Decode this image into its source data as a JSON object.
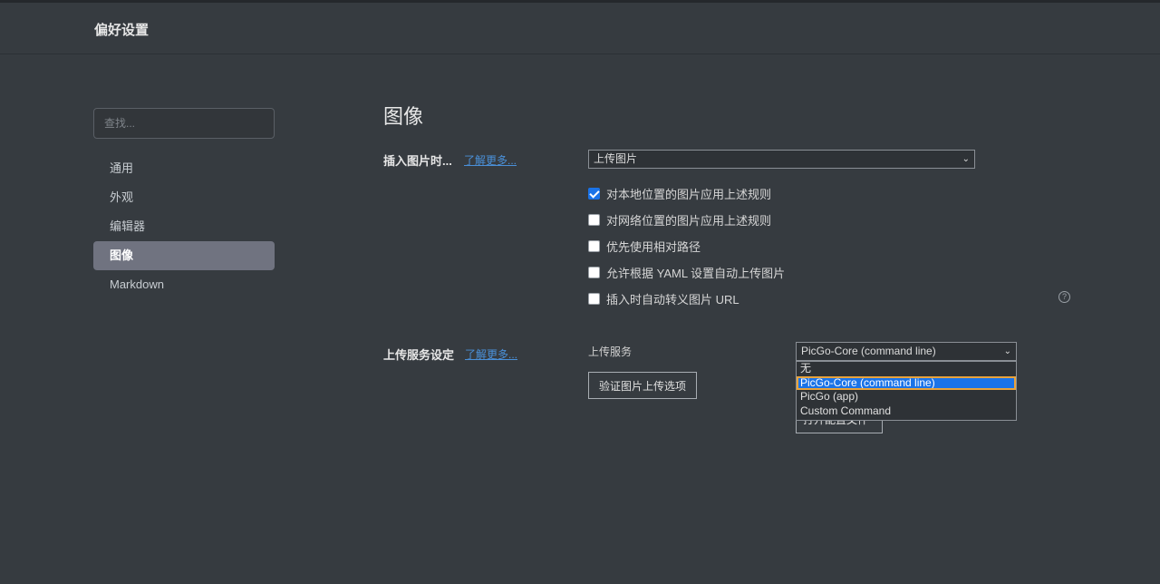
{
  "header": {
    "title": "偏好设置"
  },
  "sidebar": {
    "search_placeholder": "查找...",
    "items": [
      {
        "label": "通用"
      },
      {
        "label": "外观"
      },
      {
        "label": "编辑器"
      },
      {
        "label": "图像"
      },
      {
        "label": "Markdown"
      }
    ]
  },
  "main": {
    "title": "图像",
    "insert_section": {
      "label": "插入图片时...",
      "learn_more": "了解更多...",
      "select_value": "上传图片",
      "checkboxes": [
        {
          "label": "对本地位置的图片应用上述规则",
          "checked": true
        },
        {
          "label": "对网络位置的图片应用上述规则",
          "checked": false
        },
        {
          "label": "优先使用相对路径",
          "checked": false
        },
        {
          "label": "允许根据 YAML 设置自动上传图片",
          "checked": false
        },
        {
          "label": "插入时自动转义图片 URL",
          "checked": false
        }
      ],
      "help_icon": "question-circle-icon"
    },
    "upload_section": {
      "label": "上传服务设定",
      "learn_more": "了解更多...",
      "service_label": "上传服务",
      "service_value": "PicGo-Core (command line)",
      "verify_button": "验证图片上传选项",
      "open_config_button": "打开配置文件",
      "dropdown_options": [
        {
          "label": "无",
          "selected": false
        },
        {
          "label": "PicGo-Core (command line)",
          "selected": true
        },
        {
          "label": "PicGo (app)",
          "selected": false
        },
        {
          "label": "Custom Command",
          "selected": false
        }
      ]
    }
  },
  "colors": {
    "accent": "#1a73e8",
    "link": "#4a90d9",
    "active_nav": "#707380",
    "background": "#363b40"
  }
}
